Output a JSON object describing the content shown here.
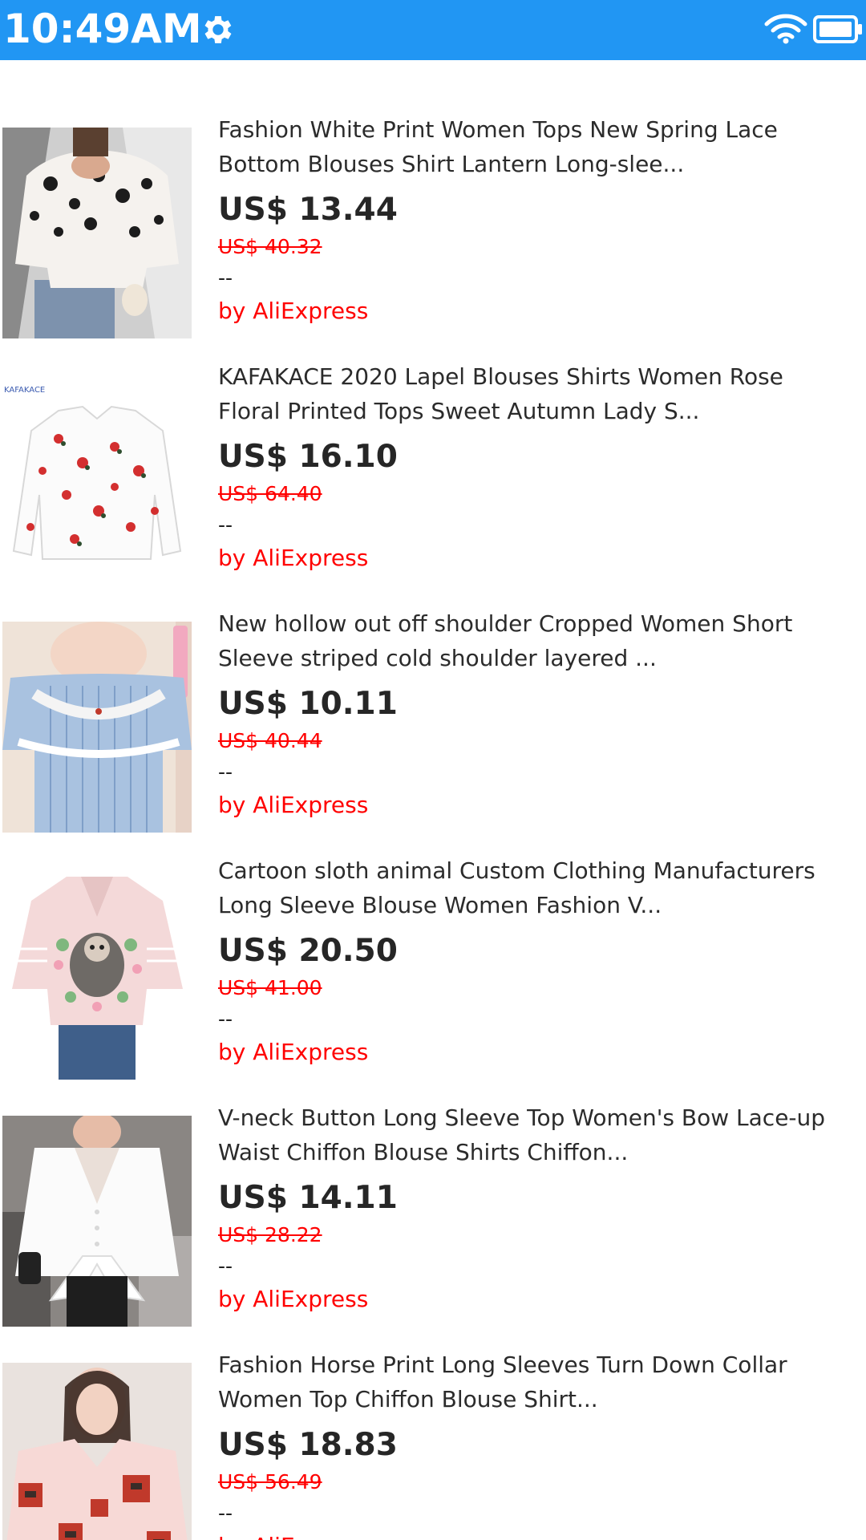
{
  "status_bar": {
    "time": "10:49AM",
    "color": "#2196F3",
    "icons": [
      "gear-icon",
      "wifi-icon",
      "battery-icon"
    ]
  },
  "products": [
    {
      "title": "Fashion White Print Women Tops New Spring Lace\nBottom Blouses Shirt Lantern Long-slee...",
      "price": "US$ 13.44",
      "old_price": "US$ 40.32",
      "rating": "--",
      "seller": "by AliExpress",
      "image": "white-floral-blouse"
    },
    {
      "title": "KAFAKACE 2020 Lapel Blouses Shirts Women Rose\nFloral Printed Tops Sweet Autumn Lady S...",
      "price": "US$ 16.10",
      "old_price": "US$ 64.40",
      "rating": "--",
      "seller": "by AliExpress",
      "image": "rose-print-shirt",
      "image_brand": "KAFAKACE"
    },
    {
      "title": "New hollow out off shoulder Cropped Women Short\nSleeve striped cold shoulder layered ...",
      "price": "US$ 10.11",
      "old_price": "US$ 40.44",
      "rating": "--",
      "seller": "by AliExpress",
      "image": "blue-striped-top"
    },
    {
      "title": "Cartoon sloth animal Custom Clothing Manufacturers\nLong Sleeve Blouse Women Fashion V...",
      "price": "US$ 20.50",
      "old_price": "US$ 41.00",
      "rating": "--",
      "seller": "by AliExpress",
      "image": "pink-sloth-blouse"
    },
    {
      "title": "V-neck Button Long Sleeve Top Women's Bow Lace-up\nWaist Chiffon Blouse Shirts Chiffon...",
      "price": "US$ 14.11",
      "old_price": "US$ 28.22",
      "rating": "--",
      "seller": "by AliExpress",
      "image": "white-bow-blouse"
    },
    {
      "title": "Fashion Horse Print Long Sleeves Turn Down Collar\nWomen Top Chiffon Blouse Shirt...",
      "price": "US$ 18.83",
      "old_price": "US$ 56.49",
      "rating": "--",
      "seller": "by AliExpress",
      "image": "horse-print-blouse"
    }
  ]
}
